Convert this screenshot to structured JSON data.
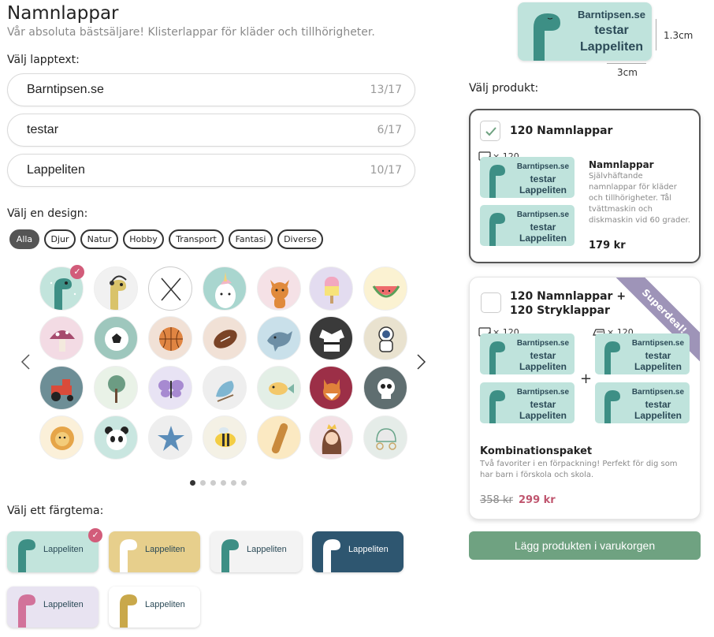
{
  "header": {
    "title": "Namnlappar",
    "subtitle": "Vår absoluta bästsäljare! Klisterlappar för kläder och tillhörigheter."
  },
  "text_section": {
    "label": "Välj lapptext:",
    "fields": [
      {
        "value": "Barntipsen.se",
        "count": "13/17"
      },
      {
        "value": "testar",
        "count": "6/17"
      },
      {
        "value": "Lappeliten",
        "count": "10/17"
      }
    ]
  },
  "design_section": {
    "label": "Välj en design:",
    "filters": [
      "Alla",
      "Djur",
      "Natur",
      "Hobby",
      "Transport",
      "Fantasi",
      "Diverse"
    ],
    "active_filter": "Alla",
    "checkmark": "✓",
    "designs": [
      "dinosaur",
      "dinosaur-headphones",
      "no-design",
      "unicorn",
      "fox",
      "ice-cream",
      "watermelon",
      "mushroom",
      "soccer-ball",
      "basketball",
      "football",
      "dolphin",
      "karate-gi",
      "astronaut",
      "tractor",
      "tree",
      "butterfly",
      "bird",
      "fish",
      "fox-red",
      "skull",
      "lion",
      "panda",
      "star",
      "bee",
      "skateboard",
      "princess",
      "carriage"
    ],
    "selected_design": "dinosaur",
    "pages": 6,
    "current_page": 1
  },
  "color_section": {
    "label": "Välj ett färgtema:",
    "theme_label": "Lappeliten",
    "themes": [
      {
        "bg": "#c2e4dc",
        "selected": true
      },
      {
        "bg": "#e7cf8c"
      },
      {
        "bg": "#f3f3f3"
      },
      {
        "bg": "#2e5670",
        "text": "#ffffff"
      },
      {
        "bg": "#e8e3f1"
      },
      {
        "bg": "#ffffff"
      }
    ]
  },
  "preview": {
    "line1": "Barntipsen.se",
    "line2": "testar",
    "line3": "Lappeliten",
    "height": "1.3cm",
    "width": "3cm"
  },
  "product_section": {
    "label": "Välj produkt:",
    "product1": {
      "title": "120 Namnlappar",
      "qty": "× 120",
      "name": "Namnlappar",
      "desc": "Självhäftande namnlappar för kläder och tillhörigheter. Tål tvättmaskin och diskmaskin vid 60 grader.",
      "price": "179 kr",
      "checked": true
    },
    "product2": {
      "title": "120 Namnlappar + 120 Stryklappar",
      "qty1": "× 120",
      "qty2": "× 120",
      "plus": "+",
      "ribbon": "Superdeal!",
      "name": "Kombinationspaket",
      "desc": "Två favoriter i en förpackning! Perfekt för dig som har barn i förskola och skola.",
      "old_price": "358 kr",
      "price": "299 kr"
    }
  },
  "add_button": "Lägg produkten i varukorgen",
  "colors": {
    "accent": "#6fa281",
    "check": "#d25c7a",
    "price_sale": "#c0566f",
    "label_bg": "#bfe3dc"
  }
}
